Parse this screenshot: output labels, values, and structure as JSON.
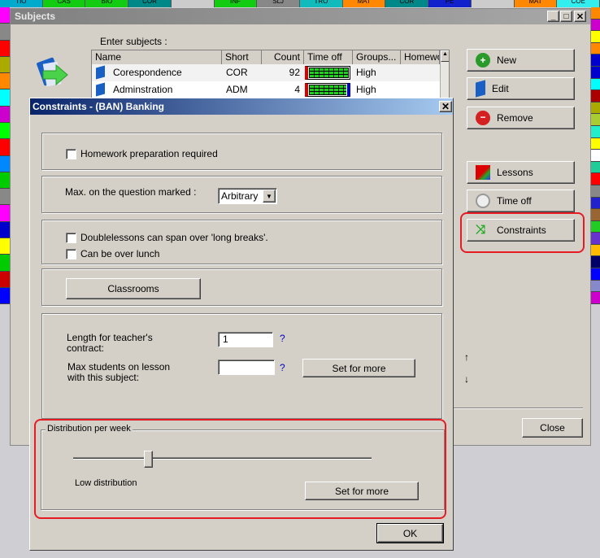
{
  "background": {
    "top_cells": [
      "TIO",
      "CAS",
      "BIO",
      "COR",
      "",
      "INF",
      "SLJ",
      "TRO",
      "MAT",
      "COR",
      "PE",
      "",
      "MAT",
      "COE"
    ],
    "top_colors": [
      "#0ac",
      "#1c1",
      "#1c1",
      "#088",
      "#ccc",
      "#1c1",
      "#888",
      "#1bb",
      "#f80",
      "#088",
      "#12c",
      "#ccc",
      "#f80",
      "#3ee"
    ],
    "left_colors": [
      "#f0f",
      "#888",
      "#f00",
      "#aa0",
      "#f80",
      "#0ff",
      "#c0c",
      "#0f0",
      "#f00",
      "#08f",
      "#0c0",
      "#888",
      "#f0f",
      "#00c",
      "#ff0",
      "#0c0",
      "#c00",
      "#00f"
    ],
    "right_colors": [
      "#f80",
      "#c0c",
      "#ff0",
      "#f80",
      "#00c",
      "#00c",
      "#0ff",
      "#a00",
      "#aa0",
      "#ac3",
      "#2ec",
      "#ff0",
      "#fff",
      "#2c9",
      "#f00",
      "#888",
      "#22c",
      "#963",
      "#2c2",
      "#63c",
      "#fb0",
      "#006",
      "#00f",
      "#88c",
      "#c0c"
    ]
  },
  "subjects_window": {
    "title": "Subjects",
    "enter_label": "Enter subjects :",
    "columns": [
      "Name",
      "Short",
      "Count",
      "Time off",
      "Groups...",
      "Homewor"
    ],
    "rows": [
      {
        "name": "Corespondence",
        "short": "COR",
        "count": "92",
        "groups": "High"
      },
      {
        "name": "Adminstration",
        "short": "ADM",
        "count": "4",
        "groups": "High"
      }
    ],
    "buttons": {
      "new": "New",
      "edit": "Edit",
      "remove": "Remove",
      "lessons": "Lessons",
      "time_off": "Time off",
      "constraints": "Constraints",
      "close": "Close"
    },
    "arrows": {
      "up": "↑",
      "down": "↓"
    }
  },
  "constraints_dialog": {
    "title": "Constraints - (BAN) Banking",
    "homework_label": "Homework preparation required",
    "max_question_label": "Max. on the question marked :",
    "max_question_value": "Arbitrary",
    "doublelessons_label": "Doublelessons can span over 'long breaks'.",
    "over_lunch_label": "Can be over lunch",
    "classrooms_button": "Classrooms",
    "contract_label": "Length for teacher's contract:",
    "contract_value": "1",
    "max_students_label": "Max students on lesson with this subject:",
    "max_students_value": "",
    "help": "?",
    "set_for_more": "Set for more",
    "distribution": {
      "title": "Distribution per week",
      "level_percent": 25,
      "value_label": "Low distribution",
      "set_for_more": "Set for more"
    },
    "ok": "OK"
  },
  "highlight_color": "#e51c23"
}
